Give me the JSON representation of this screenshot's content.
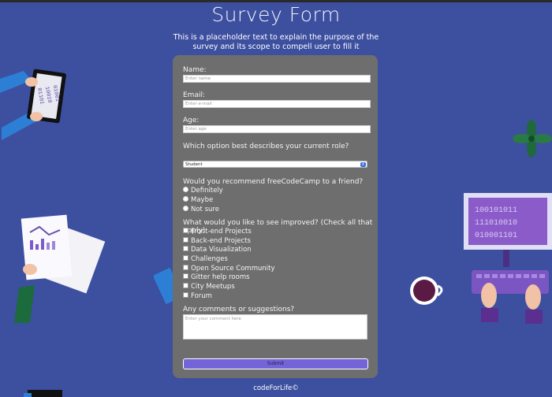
{
  "page": {
    "title": "Survey Form",
    "description": "This is a placeholder text to explain the purpose of the survey and its scope to compell user to fill it",
    "footer": "codeForLife©"
  },
  "form": {
    "name": {
      "label": "Name:",
      "placeholder": "Enter name"
    },
    "email": {
      "label": "Email:",
      "placeholder": "Enter e-mail"
    },
    "age": {
      "label": "Age:",
      "placeholder": "Enter age"
    },
    "role": {
      "label": "Which option best describes your current role?",
      "selected": "Student"
    },
    "recommend": {
      "label": "Would you recommend freeCodeCamp to a friend?",
      "options": [
        "Definitely",
        "Maybe",
        "Not sure"
      ]
    },
    "improve": {
      "label": "What would you like to see improved? (Check all that apply)",
      "options": [
        "Front-end Projects",
        "Back-end Projects",
        "Data Visualization",
        "Challenges",
        "Open Source Community",
        "Gitter help rooms",
        "City Meetups",
        "Forum"
      ]
    },
    "comments": {
      "label": "Any comments or suggestions?",
      "placeholder": "Enter your comment here"
    },
    "submit_label": "Submit"
  },
  "decor": {
    "tablet_text": [
      "01001",
      "10010",
      "01101"
    ],
    "screen_text": [
      "100101011",
      "111010010",
      "010001101"
    ]
  },
  "colors": {
    "background": "#3d4f9f",
    "card": "#6e6e6e",
    "submit": "#7464d9"
  }
}
